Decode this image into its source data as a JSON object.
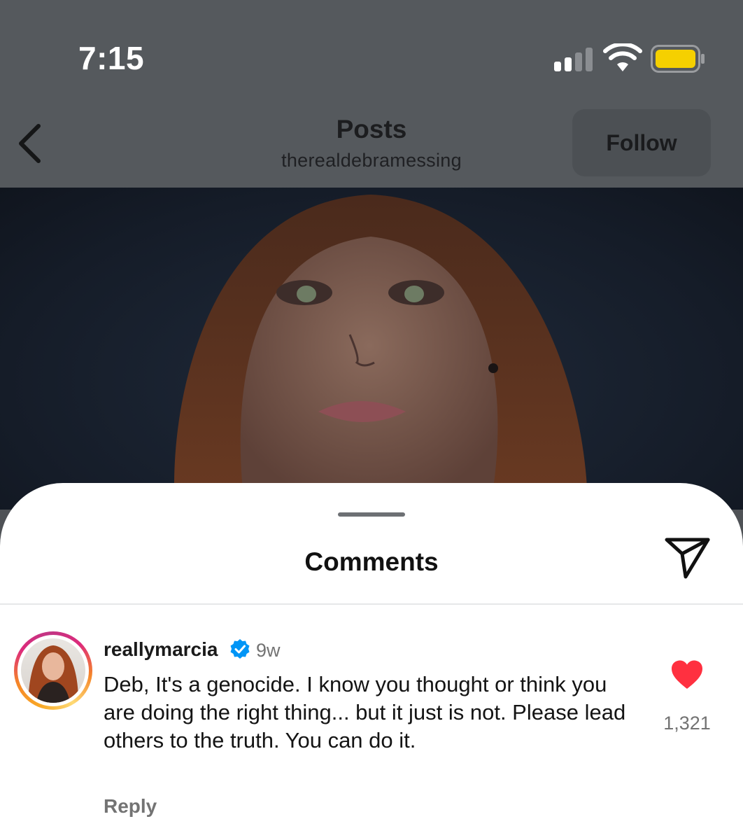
{
  "status_bar": {
    "time": "7:15",
    "battery_color": "#f5d000"
  },
  "header": {
    "title": "Posts",
    "subtitle": "therealdebramessing",
    "follow_label": "Follow",
    "back_icon": "chevron-left-icon"
  },
  "sheet": {
    "title": "Comments",
    "share_icon": "send-icon"
  },
  "comments": [
    {
      "username": "reallymarcia",
      "verified": true,
      "time_ago": "9w",
      "text": "Deb, It's a genocide. I know you thought or think you are doing the right thing... but it just is not. Please lead others to the truth. You can do it.",
      "reply_label": "Reply",
      "liked": true,
      "like_count": "1,321",
      "heart_color": "#ff3040"
    }
  ]
}
